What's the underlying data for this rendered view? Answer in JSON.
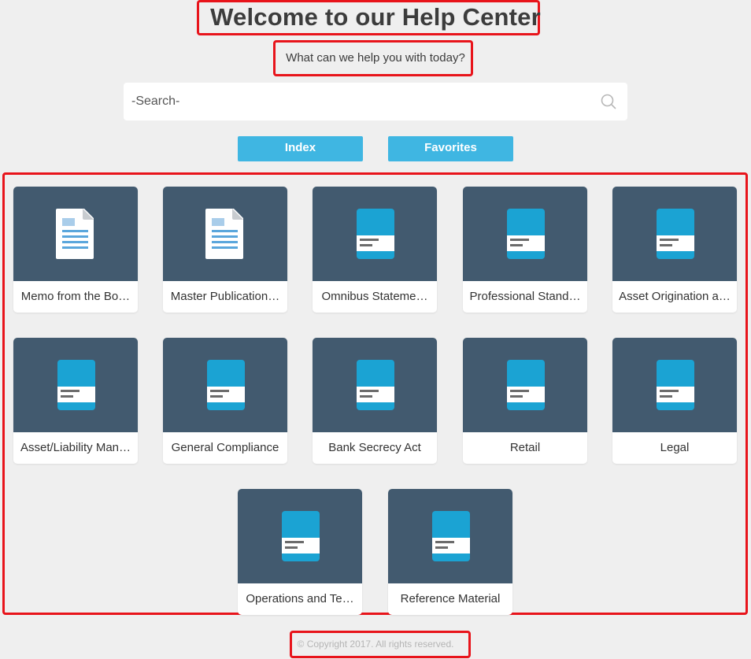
{
  "header": {
    "title": "Welcome to our Help Center",
    "subtitle": "What can we help you with today?"
  },
  "search": {
    "placeholder": "-Search-",
    "icon": "search-icon"
  },
  "buttons": {
    "index": "Index",
    "favorites": "Favorites"
  },
  "categories": [
    {
      "label": "Memo from the Bo…",
      "icon": "document-icon"
    },
    {
      "label": "Master Publication…",
      "icon": "document-icon"
    },
    {
      "label": "Omnibus Stateme…",
      "icon": "book-icon"
    },
    {
      "label": "Professional Stand…",
      "icon": "book-icon"
    },
    {
      "label": "Asset Origination a…",
      "icon": "book-icon"
    },
    {
      "label": "Asset/Liability Man…",
      "icon": "book-icon"
    },
    {
      "label": "General Compliance",
      "icon": "book-icon"
    },
    {
      "label": "Bank Secrecy Act",
      "icon": "book-icon"
    },
    {
      "label": "Retail",
      "icon": "book-icon"
    },
    {
      "label": "Legal",
      "icon": "book-icon"
    },
    {
      "label": "Operations and Te…",
      "icon": "book-icon"
    },
    {
      "label": "Reference Material",
      "icon": "book-icon"
    }
  ],
  "footer": {
    "copyright": "© Copyright 2017. All rights reserved."
  },
  "colors": {
    "background": "#efefef",
    "accent_button": "#3fb6e2",
    "card_thumb": "#425a6f",
    "book_cover": "#1ba3d3",
    "highlight_box": "#e8141b"
  }
}
